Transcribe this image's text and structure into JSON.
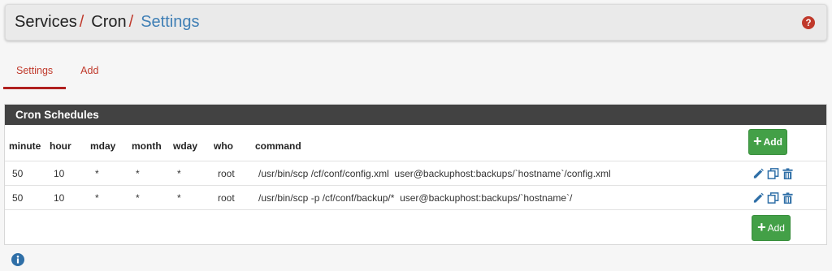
{
  "breadcrumb": {
    "items": [
      "Services",
      "Cron"
    ],
    "separator": "/",
    "current": "Settings"
  },
  "tabs": [
    {
      "label": "Settings",
      "active": true
    },
    {
      "label": "Add",
      "active": false
    }
  ],
  "panel": {
    "title": "Cron Schedules",
    "columns": [
      "minute",
      "hour",
      "mday",
      "month",
      "wday",
      "who",
      "command"
    ],
    "rows": [
      {
        "minute": "50",
        "hour": "10",
        "mday": "*",
        "month": "*",
        "wday": "*",
        "who": "root",
        "command": "/usr/bin/scp /cf/conf/config.xml  user@backuphost:backups/`hostname`/config.xml"
      },
      {
        "minute": "50",
        "hour": "10",
        "mday": "*",
        "month": "*",
        "wday": "*",
        "who": "root",
        "command": "/usr/bin/scp -p /cf/conf/backup/*  user@backuphost:backups/`hostname`/"
      }
    ],
    "add_label": "Add"
  },
  "icons": {
    "help": "help-icon",
    "info": "info-icon",
    "edit": "pencil-icon",
    "copy": "copy-icon",
    "delete": "trash-icon"
  },
  "colors": {
    "accent_red": "#c0392b",
    "link_blue": "#3f7fb5",
    "heading_bg": "#424242",
    "add_green": "#43a047"
  }
}
